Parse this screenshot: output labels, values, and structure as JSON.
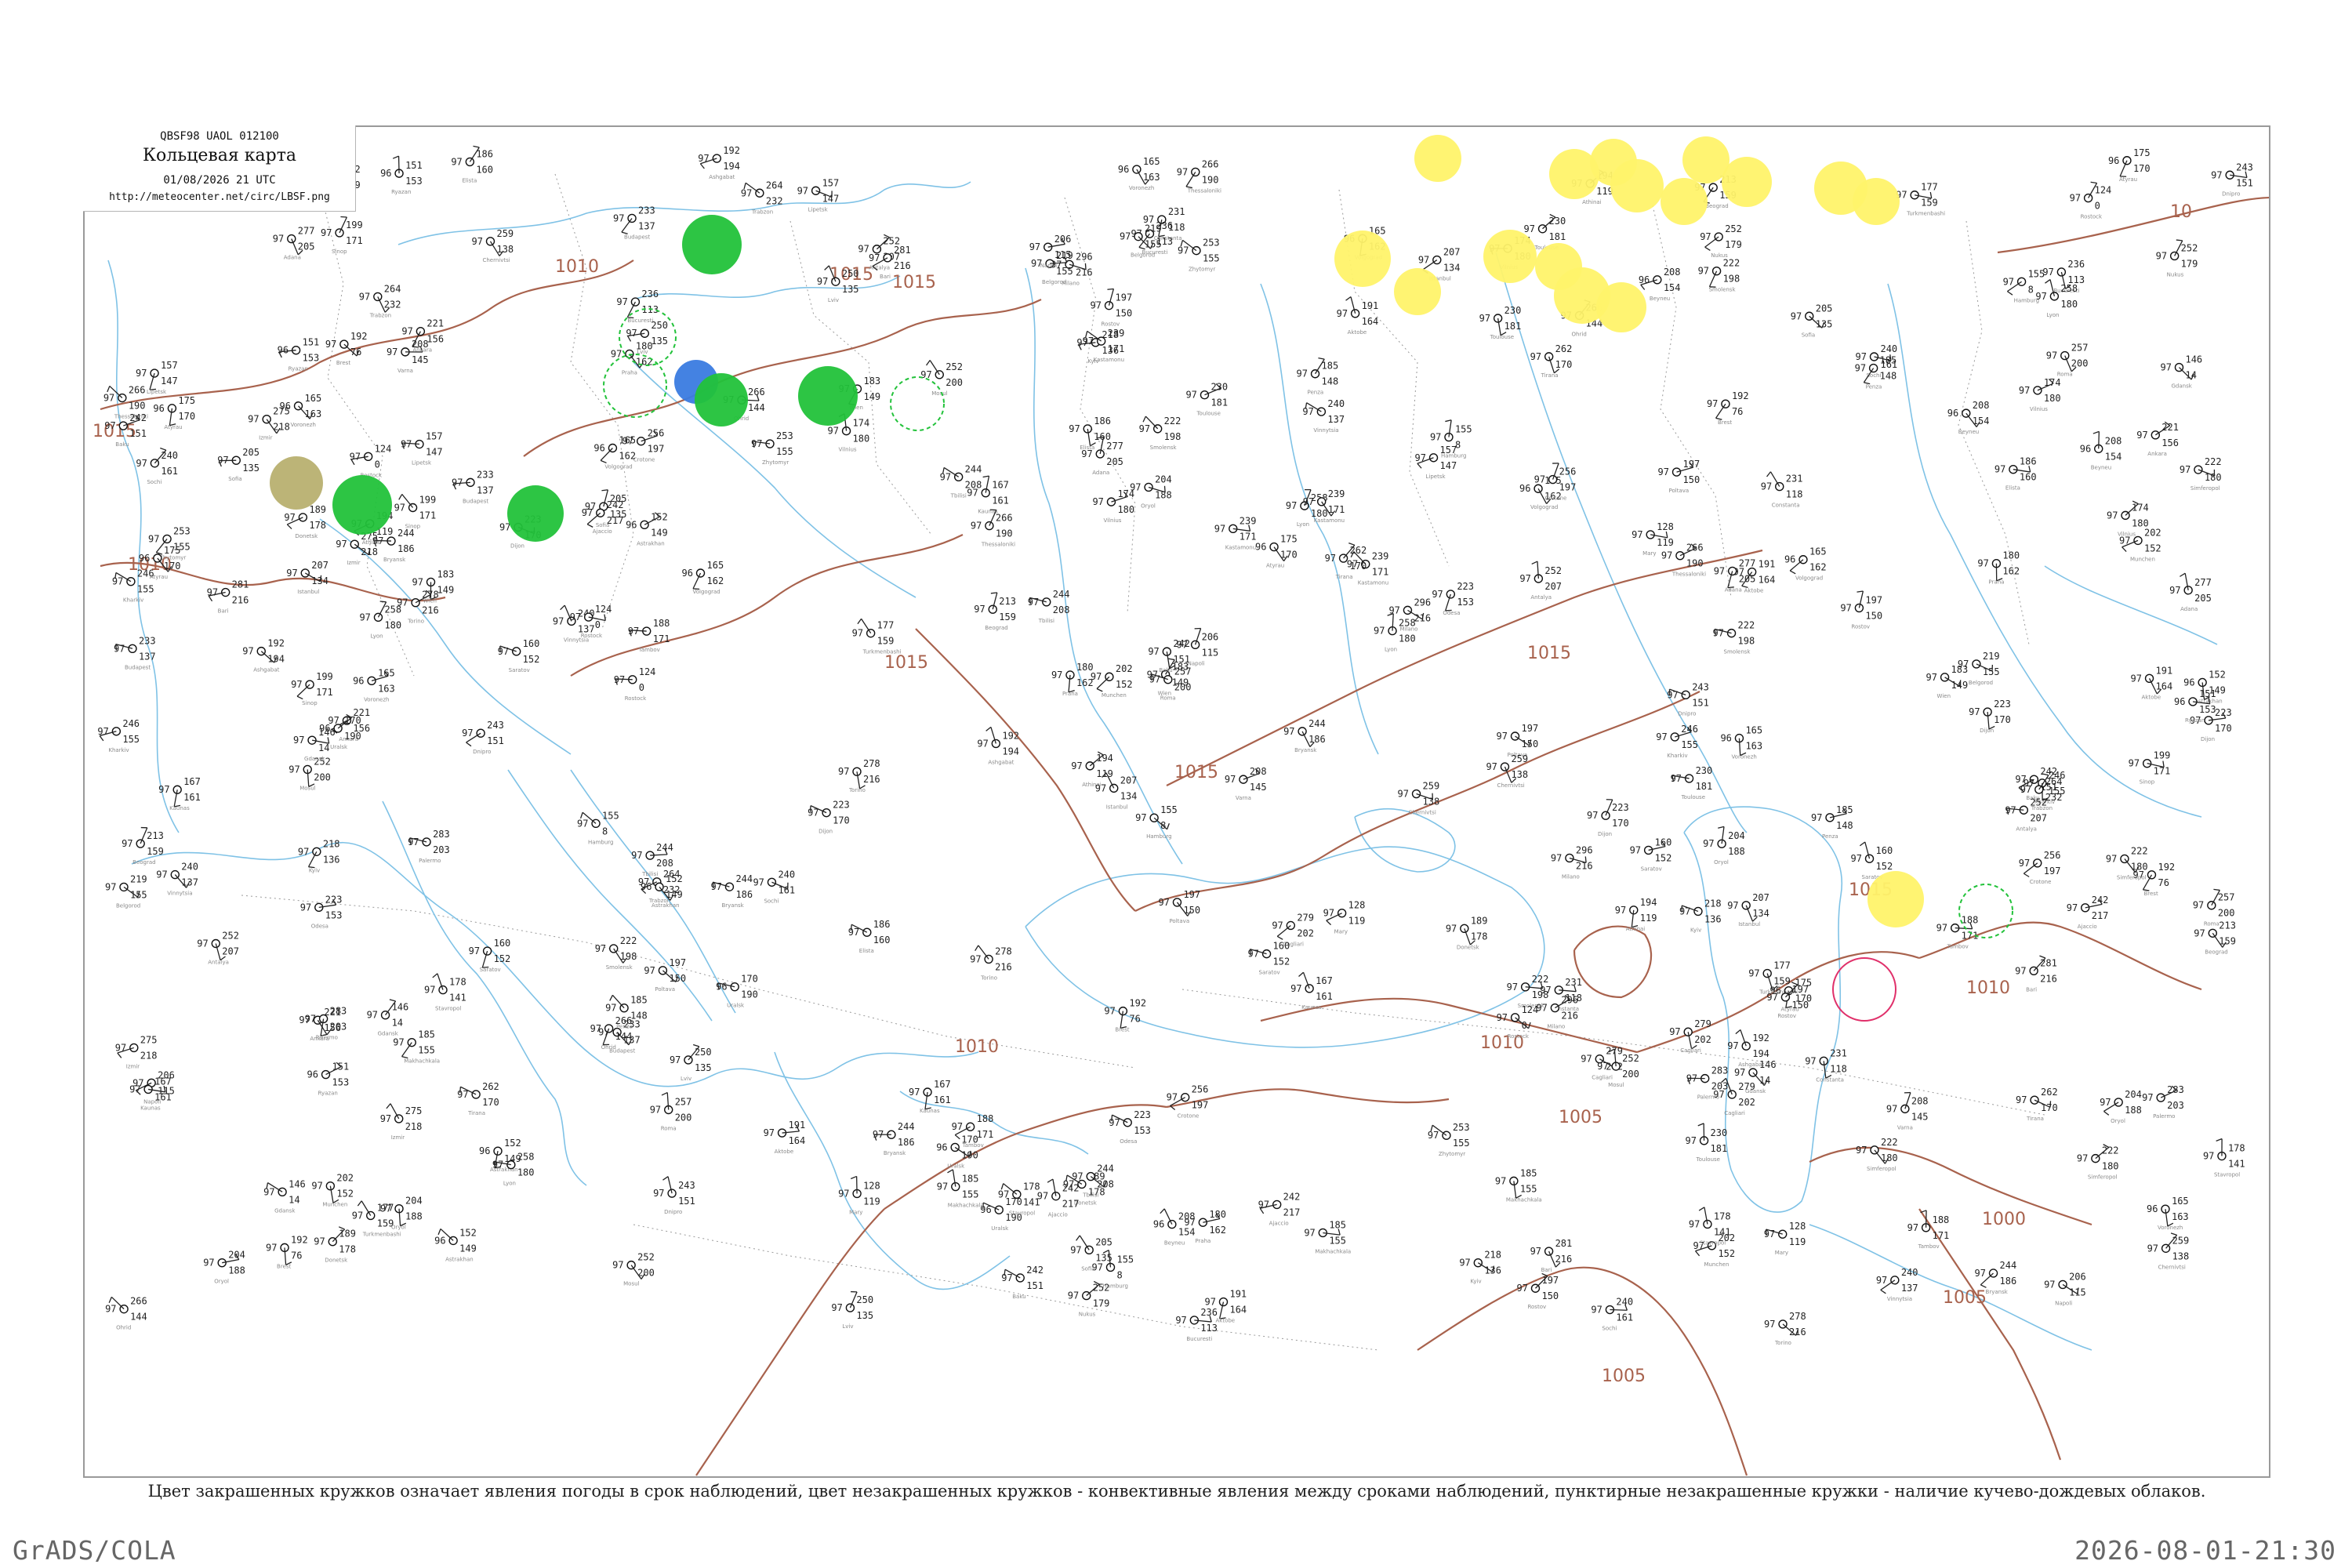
{
  "header": {
    "product_code": "QBSF98  UAOL  012100",
    "title": "Кольцевая карта",
    "date": "01/08/2026 21 UTC",
    "url": "http://meteocenter.net/circ/LBSF.png"
  },
  "caption": "Цвет закрашенных кружков означает явления погоды в срок наблюдений, цвет незакрашенных кружков - конвективные явления между сроками наблюдений, пунктирные незакрашенные кружки - наличие кучево-дождевых облаков.",
  "footer": {
    "software": "GrADS/COLA",
    "timestamp": "2026-08-01-21:30"
  },
  "map": {
    "colors": {
      "isobar": "#a8624d",
      "water": "#7fc2e6",
      "thunderstorm_green": "#22c23a",
      "shower_yellow": "#fff36a",
      "rain_blue": "#3a7be0",
      "haze_olive": "#b8b070",
      "convective_red": "#e0306a"
    },
    "isobar_labels": [
      {
        "id": "iso-1015-w",
        "text": "1015"
      },
      {
        "id": "iso-1010-w",
        "text": "1010"
      },
      {
        "id": "iso-1010-c",
        "text": "1010"
      },
      {
        "id": "iso-1015-n",
        "text": "1015"
      },
      {
        "id": "iso-1015-n2",
        "text": "1015"
      },
      {
        "id": "iso-1015-c",
        "text": "1015"
      },
      {
        "id": "iso-1015-c2",
        "text": "1015"
      },
      {
        "id": "iso-1010-s",
        "text": "1010"
      },
      {
        "id": "iso-1010-se",
        "text": "1010"
      },
      {
        "id": "iso-1005-se",
        "text": "1005"
      },
      {
        "id": "iso-1005-s",
        "text": "1005"
      },
      {
        "id": "iso-1005-e",
        "text": "1005"
      },
      {
        "id": "iso-1000-e",
        "text": "1000"
      },
      {
        "id": "iso-1010-e",
        "text": "1010"
      },
      {
        "id": "iso-1015-e",
        "text": "1015"
      },
      {
        "id": "iso-1015-ne",
        "text": "1015"
      },
      {
        "id": "iso-1010-ne",
        "text": "10"
      }
    ],
    "stations": [
      {
        "p": "155",
        "t": "97",
        "d": "8",
        "name": "Hamburg"
      },
      {
        "p": "124",
        "t": "97",
        "d": "0",
        "name": "Rostock"
      },
      {
        "p": "146",
        "t": "97",
        "d": "14",
        "name": "Gdansk"
      },
      {
        "p": "167",
        "t": "97",
        "d": "161",
        "name": "Kaunas"
      },
      {
        "p": "174",
        "t": "97",
        "d": "180",
        "name": "Vilnius"
      },
      {
        "p": "222",
        "t": "97",
        "d": "198",
        "name": "Smolensk"
      },
      {
        "p": "244",
        "t": "97",
        "d": "186",
        "name": "Bryansk"
      },
      {
        "p": "204",
        "t": "97",
        "d": "188",
        "name": "Oryol"
      },
      {
        "p": "165",
        "t": "96",
        "d": "163",
        "name": "Voronezh"
      },
      {
        "p": "160",
        "t": "97",
        "d": "152",
        "name": "Saratov"
      },
      {
        "p": "165",
        "t": "96",
        "d": "162",
        "name": "Volgograd"
      },
      {
        "p": "152",
        "t": "96",
        "d": "149",
        "name": "Astrakhan"
      },
      {
        "p": "175",
        "t": "96",
        "d": "170",
        "name": "Atyrau"
      },
      {
        "p": "191",
        "t": "97",
        "d": "164",
        "name": "Aktobe"
      },
      {
        "p": "192",
        "t": "97",
        "d": "76",
        "name": "Brest"
      },
      {
        "p": "223",
        "t": "97",
        "d": "170",
        "name": "Dijon"
      },
      {
        "p": "258",
        "t": "97",
        "d": "180",
        "name": "Lyon"
      },
      {
        "p": "230",
        "t": "97",
        "d": "181",
        "name": "Toulouse"
      },
      {
        "p": "296",
        "t": "97",
        "d": "216",
        "name": "Milano"
      },
      {
        "p": "278",
        "t": "97",
        "d": "216",
        "name": "Torino"
      },
      {
        "p": "202",
        "t": "97",
        "d": "152",
        "name": "Munchen"
      },
      {
        "p": "183",
        "t": "97",
        "d": "149",
        "name": "Wien"
      },
      {
        "p": "180",
        "t": "97",
        "d": "162",
        "name": "Praha"
      },
      {
        "p": "233",
        "t": "97",
        "d": "137",
        "name": "Budapest"
      },
      {
        "p": "250",
        "t": "97",
        "d": "135",
        "name": "Lviv"
      },
      {
        "p": "259",
        "t": "97",
        "d": "138",
        "name": "Chernivtsi"
      },
      {
        "p": "218",
        "t": "97",
        "d": "136",
        "name": "Kyiv"
      },
      {
        "p": "253",
        "t": "97",
        "d": "155",
        "name": "Zhytomyr"
      },
      {
        "p": "240",
        "t": "97",
        "d": "137",
        "name": "Vinnytsia"
      },
      {
        "p": "197",
        "t": "97",
        "d": "150",
        "name": "Poltava"
      },
      {
        "p": "246",
        "t": "97",
        "d": "155",
        "name": "Kharkiv"
      },
      {
        "p": "219",
        "t": "97",
        "d": "155",
        "name": "Belgorod"
      },
      {
        "p": "189",
        "t": "97",
        "d": "178",
        "name": "Donetsk"
      },
      {
        "p": "197",
        "t": "97",
        "d": "150",
        "name": "Rostov"
      },
      {
        "p": "186",
        "t": "97",
        "d": "160",
        "name": "Elista"
      },
      {
        "p": "178",
        "t": "97",
        "d": "141",
        "name": "Stavropol"
      },
      {
        "p": "185",
        "t": "97",
        "d": "155",
        "name": "Makhachkala"
      },
      {
        "p": "240",
        "t": "97",
        "d": "161",
        "name": "Sochi"
      },
      {
        "p": "223",
        "t": "97",
        "d": "153",
        "name": "Odesa"
      },
      {
        "p": "222",
        "t": "97",
        "d": "180",
        "name": "Simferopol"
      },
      {
        "p": "231",
        "t": "97",
        "d": "118",
        "name": "Constanta"
      },
      {
        "p": "236",
        "t": "97",
        "d": "113",
        "name": "Bucuresti"
      },
      {
        "p": "205",
        "t": "97",
        "d": "135",
        "name": "Sofia"
      },
      {
        "p": "208",
        "t": "97",
        "d": "145",
        "name": "Varna"
      },
      {
        "p": "207",
        "t": "97",
        "d": "134",
        "name": "Istanbul"
      },
      {
        "p": "221",
        "t": "97",
        "d": "156",
        "name": "Ankara"
      },
      {
        "p": "275",
        "t": "97",
        "d": "218",
        "name": "Izmir"
      },
      {
        "p": "266",
        "t": "97",
        "d": "190",
        "name": "Thessaloniki"
      },
      {
        "p": "194",
        "t": "97",
        "d": "119",
        "name": "Athinai"
      },
      {
        "p": "252",
        "t": "97",
        "d": "207",
        "name": "Antalya"
      },
      {
        "p": "277",
        "t": "97",
        "d": "205",
        "name": "Adana"
      },
      {
        "p": "264",
        "t": "97",
        "d": "232",
        "name": "Trabzon"
      },
      {
        "p": "244",
        "t": "97",
        "d": "208",
        "name": "Tbilisi"
      },
      {
        "p": "242",
        "t": "97",
        "d": "151",
        "name": "Baku"
      },
      {
        "p": "177",
        "t": "97",
        "d": "159",
        "name": "Turkmenbashi"
      },
      {
        "p": "208",
        "t": "96",
        "d": "154",
        "name": "Beyneu"
      },
      {
        "p": "252",
        "t": "97",
        "d": "179",
        "name": "Nukus"
      },
      {
        "p": "192",
        "t": "97",
        "d": "194",
        "name": "Ashgabat"
      },
      {
        "p": "128",
        "t": "97",
        "d": "119",
        "name": "Mary"
      },
      {
        "p": "257",
        "t": "97",
        "d": "200",
        "name": "Roma"
      },
      {
        "p": "206",
        "t": "97",
        "d": "115",
        "name": "Napoli"
      },
      {
        "p": "279",
        "t": "97",
        "d": "202",
        "name": "Cagliari"
      },
      {
        "p": "283",
        "t": "97",
        "d": "203",
        "name": "Palermo"
      },
      {
        "p": "242",
        "t": "97",
        "d": "217",
        "name": "Ajaccio"
      },
      {
        "p": "281",
        "t": "97",
        "d": "216",
        "name": "Bari"
      },
      {
        "p": "213",
        "t": "97",
        "d": "159",
        "name": "Beograd"
      },
      {
        "p": "262",
        "t": "97",
        "d": "170",
        "name": "Tirana"
      },
      {
        "p": "239",
        "t": "97",
        "d": "171",
        "name": "Kastamonu"
      },
      {
        "p": "199",
        "t": "97",
        "d": "171",
        "name": "Sinop"
      },
      {
        "p": "252",
        "t": "97",
        "d": "200",
        "name": "Mosul"
      },
      {
        "p": "266",
        "t": "97",
        "d": "144",
        "name": "Ohrid"
      },
      {
        "p": "256",
        "t": "97",
        "d": "197",
        "name": "Crotone"
      },
      {
        "p": "185",
        "t": "97",
        "d": "148",
        "name": "Penza"
      },
      {
        "p": "170",
        "t": "96",
        "d": "190",
        "name": "Uralsk"
      },
      {
        "p": "151",
        "t": "96",
        "d": "153",
        "name": "Ryazan"
      },
      {
        "p": "188",
        "t": "97",
        "d": "171",
        "name": "Tambov"
      },
      {
        "p": "157",
        "t": "97",
        "d": "147",
        "name": "Lipetsk"
      },
      {
        "p": "243",
        "t": "97",
        "d": "151",
        "name": "Dnipro"
      }
    ]
  }
}
